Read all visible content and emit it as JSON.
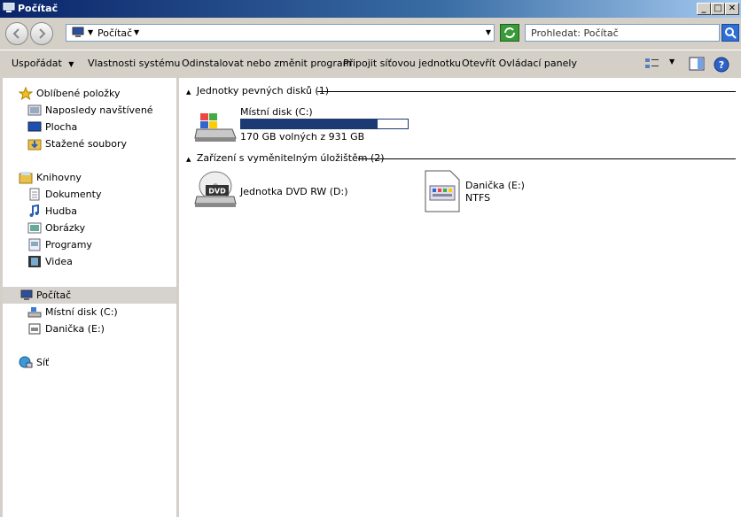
{
  "window": {
    "title": "Počítač"
  },
  "address": {
    "crumb": "Počítač",
    "search_placeholder": "Prohledat: Počítač"
  },
  "toolbar": {
    "organize": "Uspořádat",
    "system_properties": "Vlastnosti systému",
    "uninstall": "Odinstalovat nebo změnit program",
    "map_drive": "Připojit síťovou jednotku",
    "control_panel": "Otevřít Ovládací panely"
  },
  "nav": {
    "favorites": {
      "label": "Oblíbené položky",
      "items": [
        "Naposledy navštívené",
        "Plocha",
        "Stažené soubory"
      ]
    },
    "libraries": {
      "label": "Knihovny",
      "items": [
        "Dokumenty",
        "Hudba",
        "Obrázky",
        "Programy",
        "Videa"
      ]
    },
    "computer": {
      "label": "Počítač",
      "items": [
        "Místní disk (C:)",
        "Danička (E:)"
      ]
    },
    "network": {
      "label": "Síť"
    }
  },
  "content": {
    "hard_drives": {
      "header": "Jednotky pevných disků (1)",
      "drives": [
        {
          "name": "Místní disk (C:)",
          "free_text": "170 GB volných z 931 GB",
          "used_fraction": 0.817
        }
      ]
    },
    "removable": {
      "header": "Zařízení s vyměnitelným úložištěm (2)",
      "drives": [
        {
          "name": "Jednotka DVD RW (D:)"
        },
        {
          "name": "Danička (E:)",
          "fs": "NTFS"
        }
      ]
    }
  },
  "colors": {
    "title_bar": "#0a246a",
    "usage_bar": "#1c3b74",
    "selection": "#d6d3ce"
  }
}
